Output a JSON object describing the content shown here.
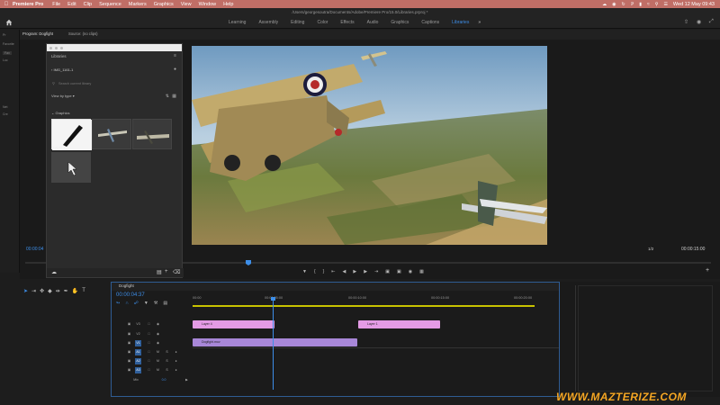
{
  "menubar": {
    "app_name": "Premiere Pro",
    "items": [
      "File",
      "Edit",
      "Clip",
      "Sequence",
      "Markers",
      "Graphics",
      "View",
      "Window",
      "Help"
    ],
    "clock": "Wed 12 May  09:43"
  },
  "titlebar": {
    "path": "/Users/georgesoutra/Documents/Adobe/Premiere Pro/15.0/Libraries.prproj *"
  },
  "workspaces": {
    "tabs": [
      "Learning",
      "Assembly",
      "Editing",
      "Color",
      "Effects",
      "Audio",
      "Graphics",
      "Captions",
      "Libraries"
    ],
    "active": "Libraries",
    "more": "»"
  },
  "left_panel": {
    "labels": [
      "Pr",
      "Favorite",
      "Fav",
      "Loc",
      "Net",
      "Cre"
    ]
  },
  "program": {
    "tabs": [
      "Program: Dogfight",
      "Source: (no clips)"
    ],
    "timecode_left": "00:00:04",
    "timecode_right": "00:00:15:00",
    "zoom": "1/2"
  },
  "libraries": {
    "header": "Libraries",
    "library_name": "IMG_1161-1",
    "search_placeholder": "Search current library",
    "view_by": "View by type",
    "section": "Graphics",
    "selected_label": "Layer 1"
  },
  "timeline": {
    "tab": "Dogfight",
    "timecode": "00:00:04:37",
    "ruler": [
      "00:00",
      "00:00:05:00",
      "00:00:10:00",
      "00:00:15:00",
      "00:00:20:00"
    ],
    "tracks": [
      "V3",
      "V2",
      "V1",
      "A1",
      "A2",
      "A3",
      "Mix"
    ],
    "mix_value": "0.0",
    "clips": [
      {
        "label": "Layer 4"
      },
      {
        "label": "Layer 1"
      },
      {
        "label": "Dogfight.mov"
      }
    ]
  },
  "watermark": "WWW.MAZTERIZE.COM",
  "colors": {
    "accent": "#3d8ee8",
    "menubar": "#c06e66",
    "clip_pink": "#e49be5",
    "clip_purple": "#a887d8"
  }
}
